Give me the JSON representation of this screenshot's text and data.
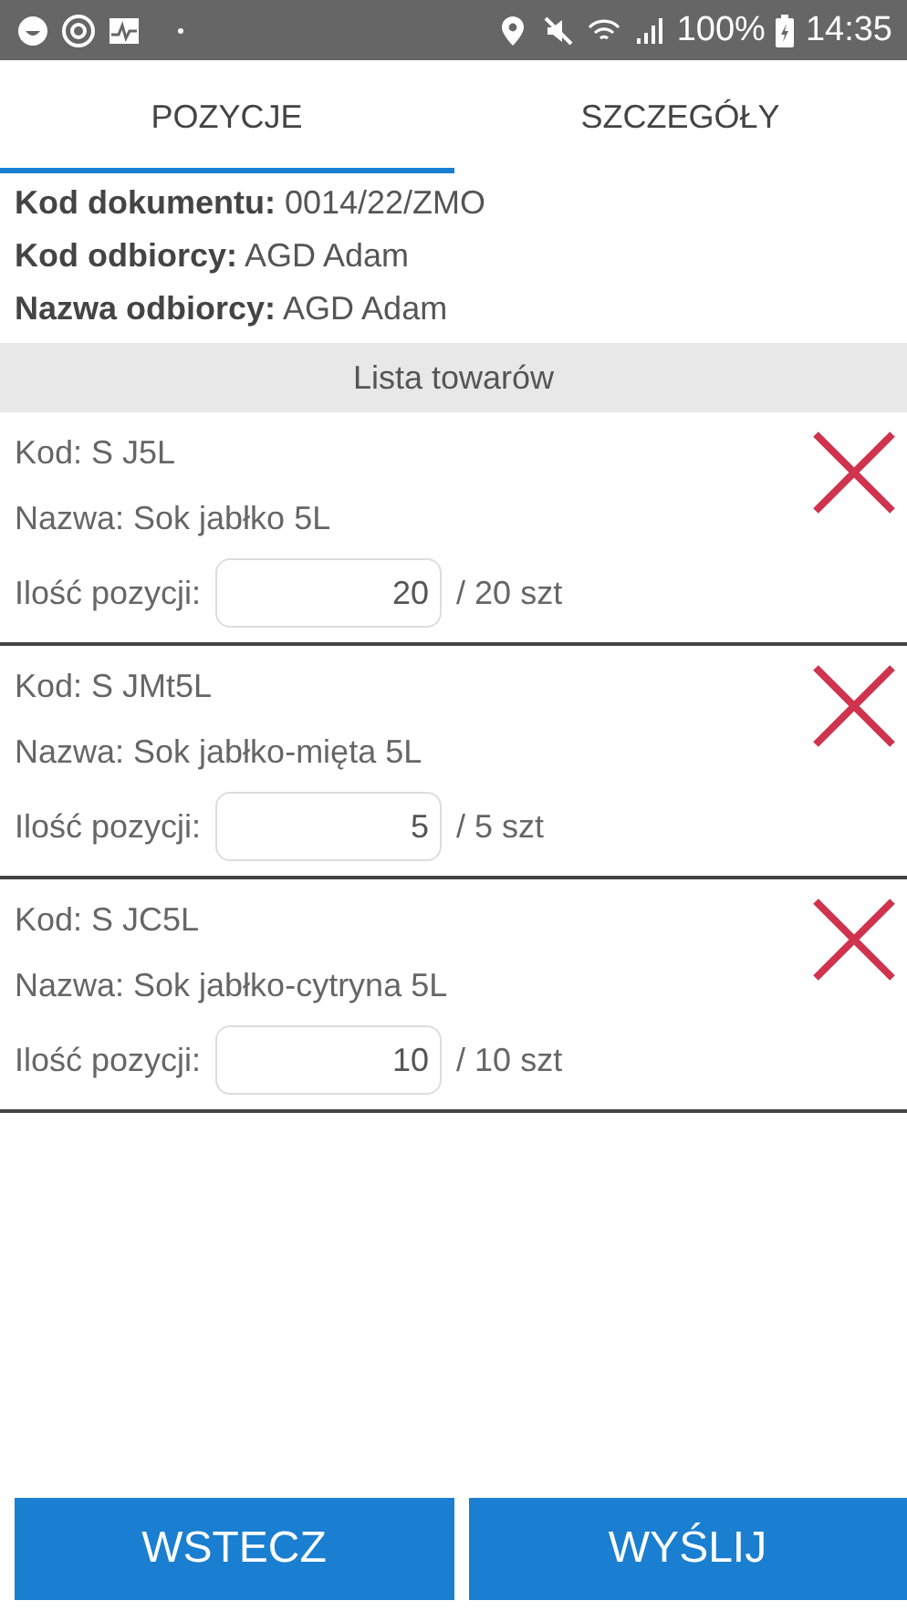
{
  "status_bar": {
    "battery": "100%",
    "time": "14:35"
  },
  "tabs": [
    {
      "label": "POZYCJE",
      "selected": true
    },
    {
      "label": "SZCZEGÓŁY",
      "selected": false
    }
  ],
  "header": [
    "**Kod dokumentu:** 0014/22/ZMO",
    "**Kod odbiorcy:** AGD Adam",
    "**Nazwa odbiorcy:** AGD Adam"
  ],
  "list_title": "Lista towarów",
  "items": [
    {
      "code": "Kod: S J5L",
      "name": "Nazwa: Sok jabłko 5L",
      "qty_label": "Ilość pozycji:",
      "qty": "20",
      "total": "/ 20 szt"
    },
    {
      "code": "Kod: S JMt5L",
      "name": "Nazwa: Sok jabłko-mięta 5L",
      "qty_label": "Ilość pozycji:",
      "qty": "5",
      "total": "/ 5 szt"
    },
    {
      "code": "Kod: S JC5L",
      "name": "Nazwa: Sok jabłko-cytryna 5L",
      "qty_label": "Ilość pozycji:",
      "qty": "10",
      "total": "/ 10 szt"
    }
  ],
  "buttons": [
    "WSTECZ",
    "WYŚLIJ"
  ]
}
